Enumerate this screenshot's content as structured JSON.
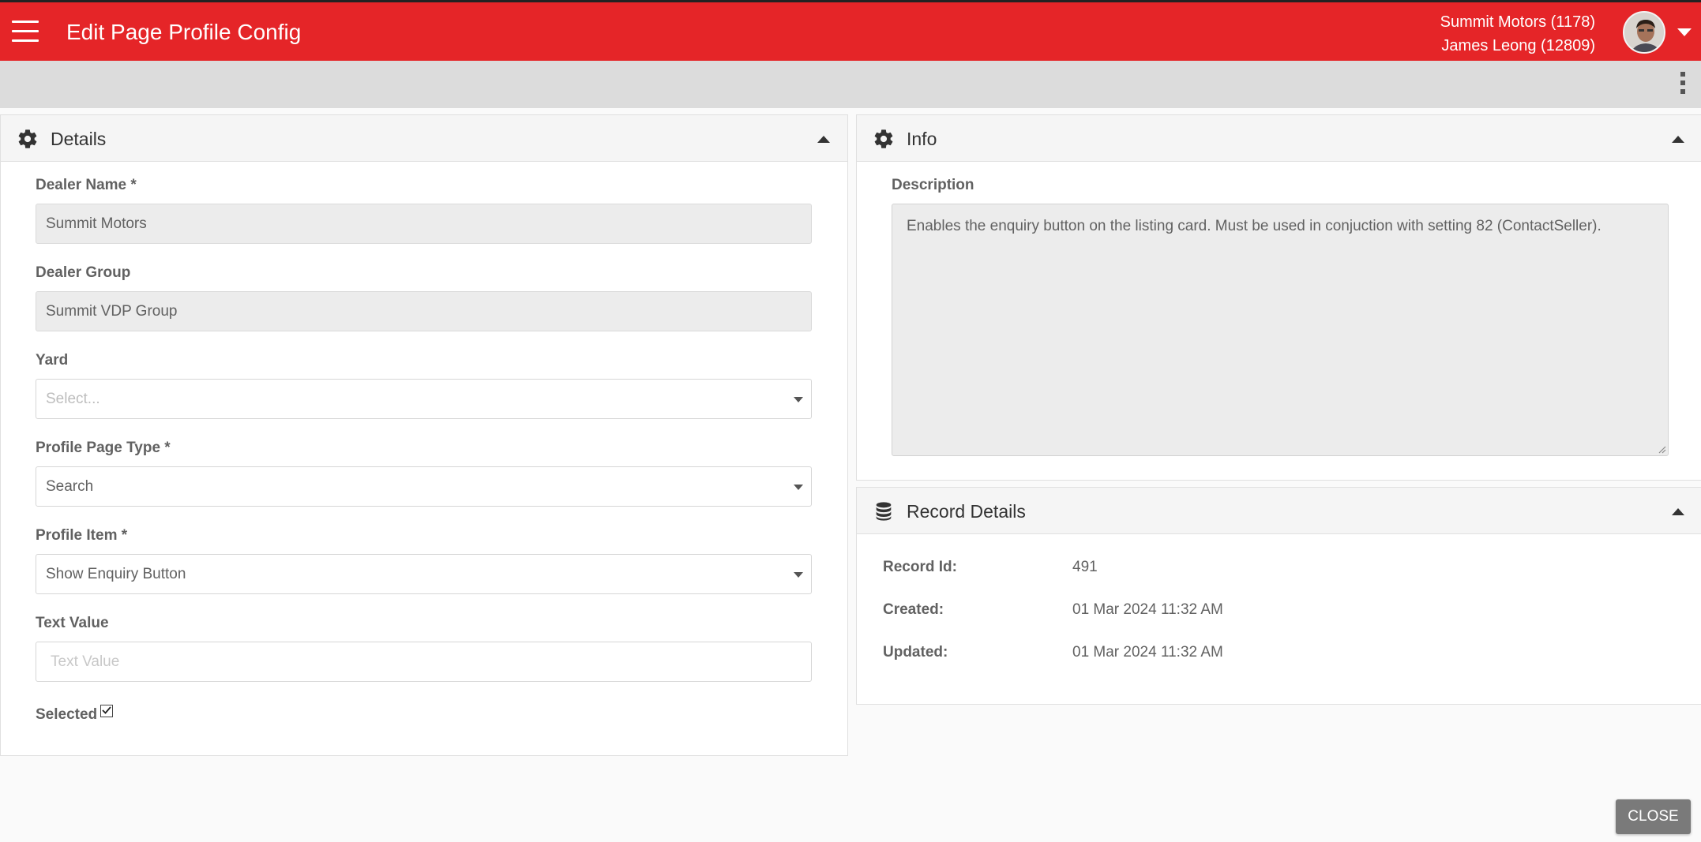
{
  "app": {
    "title": "Edit Page Profile Config",
    "dealer_line": "Summit Motors (1178)",
    "user_line": "James Leong (12809)",
    "accent_color": "#e52528"
  },
  "details": {
    "header": "Details",
    "dealer_name": {
      "label": "Dealer Name *",
      "value": "Summit Motors"
    },
    "dealer_group": {
      "label": "Dealer Group",
      "value": "Summit VDP Group"
    },
    "yard": {
      "label": "Yard",
      "placeholder": "Select..."
    },
    "profile_page_type": {
      "label": "Profile Page Type *",
      "value": "Search"
    },
    "profile_item": {
      "label": "Profile Item *",
      "value": "Show Enquiry Button"
    },
    "text_value": {
      "label": "Text Value",
      "placeholder": "Text Value"
    },
    "selected": {
      "label": "Selected",
      "checked": true
    }
  },
  "info": {
    "header": "Info",
    "description_label": "Description",
    "description": "Enables the enquiry button on the listing card. Must be used in conjuction with setting 82 (ContactSeller)."
  },
  "record": {
    "header": "Record Details",
    "rows": [
      {
        "label": "Record Id:",
        "value": "491"
      },
      {
        "label": "Created:",
        "value": "01 Mar 2024 11:32 AM"
      },
      {
        "label": "Updated:",
        "value": "01 Mar 2024 11:32 AM"
      }
    ]
  },
  "actions": {
    "close_label": "Close"
  }
}
